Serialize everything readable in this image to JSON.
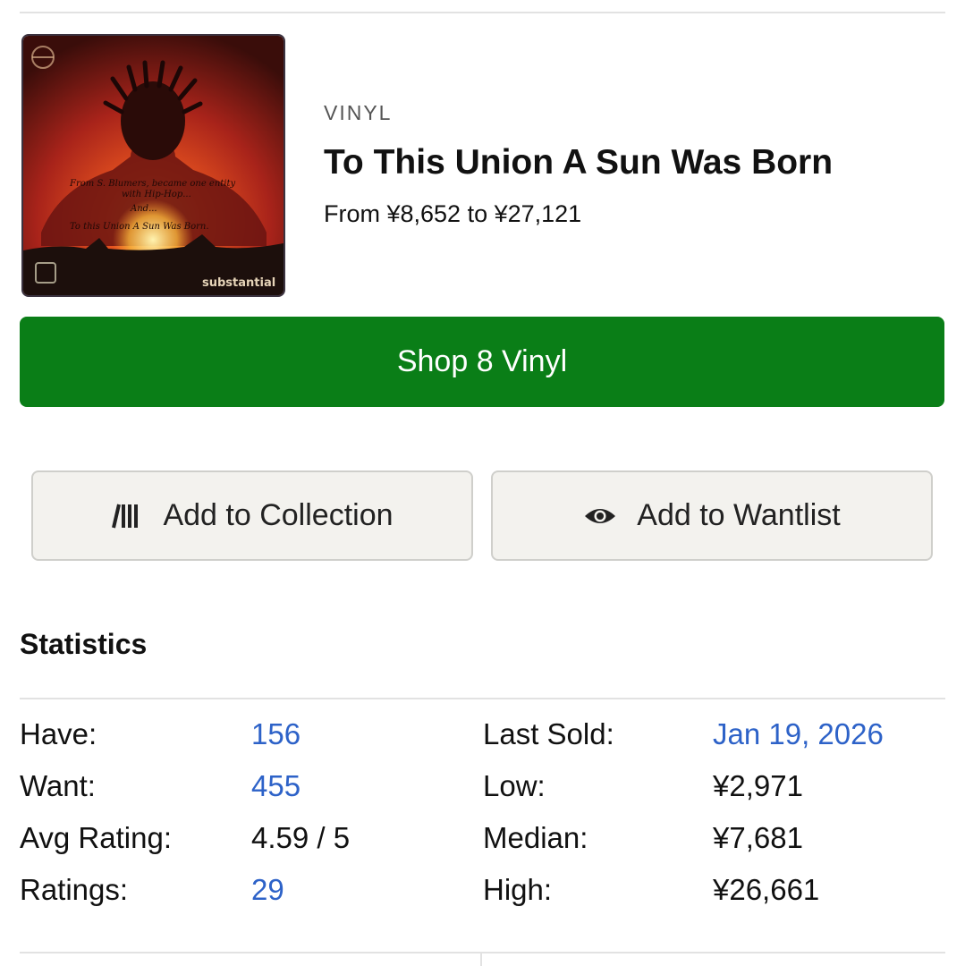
{
  "release": {
    "format": "VINYL",
    "title": "To This Union A Sun Was Born",
    "price_range": "From ¥8,652 to ¥27,121",
    "cover": {
      "handwriting": [
        "From S. Blumers, became one entity",
        "with Hip-Hop...",
        "And...",
        "To this Union A Sun Was Born."
      ],
      "label_text": "substantial",
      "colors": [
        "#1c0f0c",
        "#a8231a",
        "#e5521f",
        "#f6a23a"
      ]
    }
  },
  "actions": {
    "shop_label": "Shop 8 Vinyl",
    "collection_label": "Add to Collection",
    "wantlist_label": "Add to Wantlist",
    "collection_icon": "collection-icon",
    "wantlist_icon": "eye-icon"
  },
  "statistics": {
    "heading": "Statistics",
    "left": [
      {
        "label": "Have:",
        "value": "156",
        "link": true
      },
      {
        "label": "Want:",
        "value": "455",
        "link": true
      },
      {
        "label": "Avg Rating:",
        "value": "4.59 / 5",
        "link": false
      },
      {
        "label": "Ratings:",
        "value": "29",
        "link": true
      }
    ],
    "right": [
      {
        "label": "Last Sold:",
        "value": "Jan 19, 2026",
        "link": true
      },
      {
        "label": "Low:",
        "value": "¥2,971",
        "link": false
      },
      {
        "label": "Median:",
        "value": "¥7,681",
        "link": false
      },
      {
        "label": "High:",
        "value": "¥26,661",
        "link": false
      }
    ]
  },
  "colors": {
    "shop_button": "#0a7e17",
    "link": "#2d62c8",
    "action_button_bg": "#f3f2ee"
  }
}
